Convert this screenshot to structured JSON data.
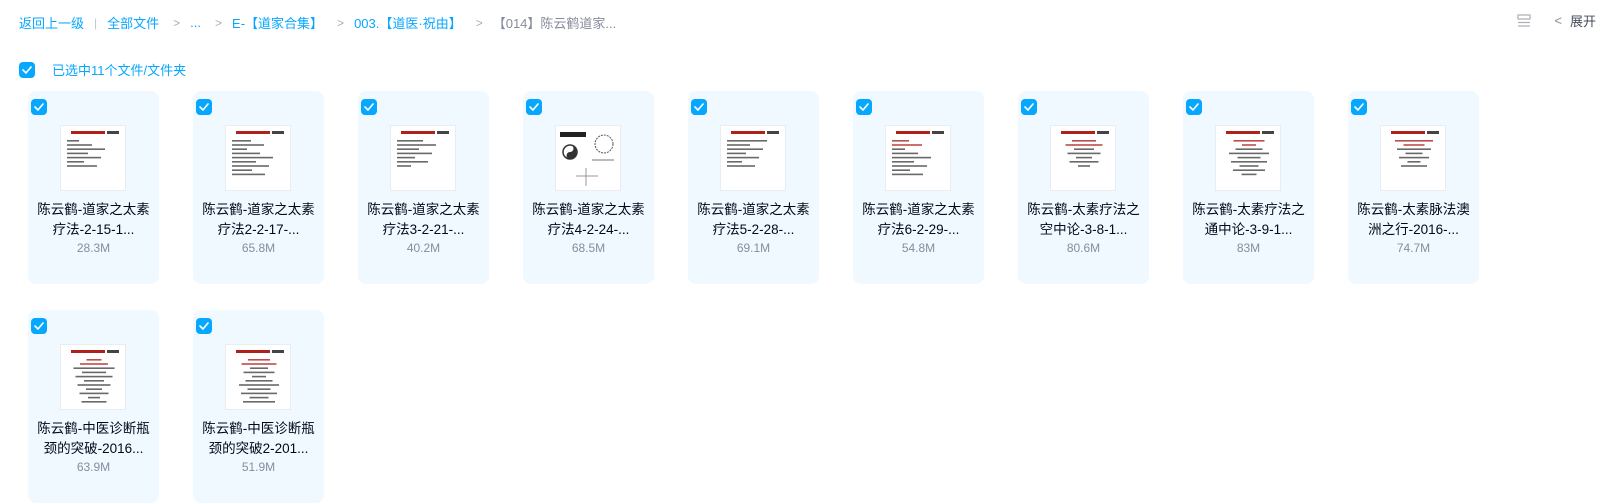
{
  "breadcrumb": {
    "back": "返回上一级",
    "all_files": "全部文件",
    "ellipsis": "...",
    "level1": "E-【道家合集】",
    "level2": "003.【道医·祝由】",
    "current": "【014】陈云鹤道家..."
  },
  "toolbar": {
    "expand_label": "展开",
    "view_icon": "list-view-icon",
    "collapse_icon": "chevron-left-icon"
  },
  "selection": {
    "checked": true,
    "label": "已选中11个文件/文件夹"
  },
  "colors": {
    "accent": "#06a7ff",
    "card_bg": "#f0f9ff",
    "muted_text": "#878c9c"
  },
  "files": [
    {
      "name_line1": "陈云鹤-道家之太素",
      "name_line2": "疗法-2-15-1...",
      "size": "28.3M",
      "checked": true
    },
    {
      "name_line1": "陈云鹤-道家之太素",
      "name_line2": "疗法2-2-17-...",
      "size": "65.8M",
      "checked": true
    },
    {
      "name_line1": "陈云鹤-道家之太素",
      "name_line2": "疗法3-2-21-...",
      "size": "40.2M",
      "checked": true
    },
    {
      "name_line1": "陈云鹤-道家之太素",
      "name_line2": "疗法4-2-24-...",
      "size": "68.5M",
      "checked": true
    },
    {
      "name_line1": "陈云鹤-道家之太素",
      "name_line2": "疗法5-2-28-...",
      "size": "69.1M",
      "checked": true
    },
    {
      "name_line1": "陈云鹤-道家之太素",
      "name_line2": "疗法6-2-29-...",
      "size": "54.8M",
      "checked": true
    },
    {
      "name_line1": "陈云鹤-太素疗法之",
      "name_line2": "空中论-3-8-1...",
      "size": "80.6M",
      "checked": true
    },
    {
      "name_line1": "陈云鹤-太素疗法之",
      "name_line2": "通中论-3-9-1...",
      "size": "83M",
      "checked": true
    },
    {
      "name_line1": "陈云鹤-太素脉法澳",
      "name_line2": "洲之行-2016-...",
      "size": "74.7M",
      "checked": true
    },
    {
      "name_line1": "陈云鹤-中医诊断瓶",
      "name_line2": "颈的突破-2016...",
      "size": "63.9M",
      "checked": true
    },
    {
      "name_line1": "陈云鹤-中医诊断瓶",
      "name_line2": "颈的突破2-201...",
      "size": "51.9M",
      "checked": true
    }
  ]
}
